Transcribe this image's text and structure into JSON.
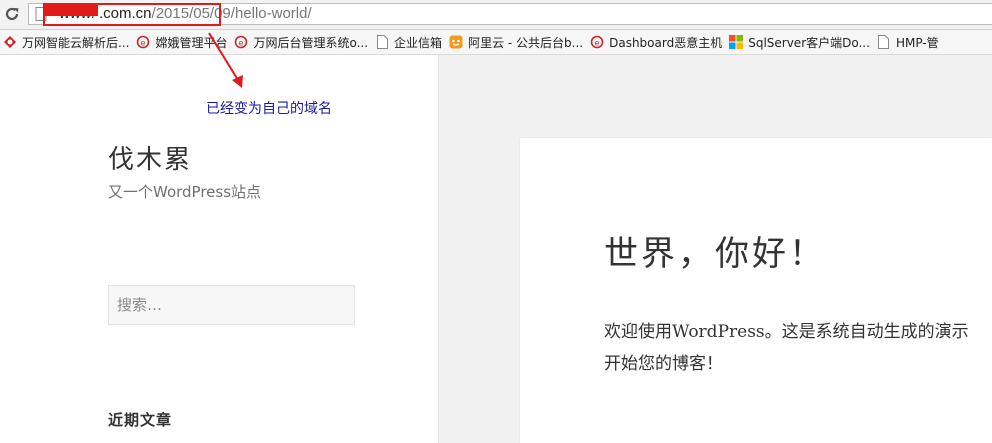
{
  "browser": {
    "url_domain": "www.            .com.cn",
    "url_path": "/2015/05/09/hello-world/"
  },
  "bookmarks": [
    {
      "label": "万网智能云解析后...",
      "icon": "wanwang-icon"
    },
    {
      "label": "嫦娥管理平台",
      "icon": "bookmark-e-icon"
    },
    {
      "label": "万网后台管理系统o...",
      "icon": "bookmark-e-icon"
    },
    {
      "label": "企业信箱",
      "icon": "page-icon"
    },
    {
      "label": "阿里云 - 公共后台b...",
      "icon": "aliyun-icon"
    },
    {
      "label": "Dashboard恶意主机",
      "icon": "bookmark-e-icon"
    },
    {
      "label": "SqlServer客户端Do...",
      "icon": "windows-icon"
    },
    {
      "label": "HMP-管",
      "icon": "page-icon"
    }
  ],
  "site": {
    "title": "伐木累",
    "description": "又一个WordPress站点"
  },
  "search": {
    "placeholder": "搜索…"
  },
  "widget": {
    "recent_posts_title": "近期文章"
  },
  "post": {
    "title": "世界，你好！",
    "body_line1": "欢迎使用WordPress。这是系统自动生成的演示",
    "body_line2": "开始您的博客！"
  },
  "annotation": {
    "text": "已经变为自己的域名",
    "color": "#e21a1a"
  }
}
